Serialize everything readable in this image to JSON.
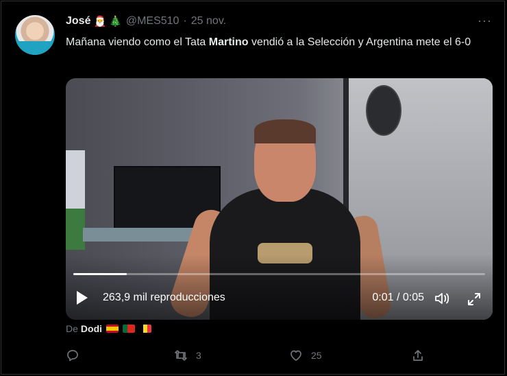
{
  "tweet": {
    "name": "José",
    "name_emojis": [
      "🎅",
      "🎄"
    ],
    "handle": "@MES510",
    "separator": "·",
    "date": "25 nov.",
    "more_label": "···",
    "text_before": "Mañana viendo como el Tata ",
    "text_bold": "Martino",
    "text_after": " vendió a la Selección y Argentina mete el 6-0"
  },
  "video": {
    "views": "263,9 mil reproducciones",
    "time": "0:01 / 0:05",
    "progress": 0.13
  },
  "from": {
    "prefix": "De",
    "name": "Dodi",
    "flags": [
      "Spain flag",
      "Portugal flag",
      "Belgium flag"
    ]
  },
  "actions": {
    "reply_count": "",
    "retweet_count": "3",
    "like_count": "25"
  },
  "colors": {
    "background": "#000000",
    "text": "#e7e9ea",
    "muted": "#71767b"
  }
}
